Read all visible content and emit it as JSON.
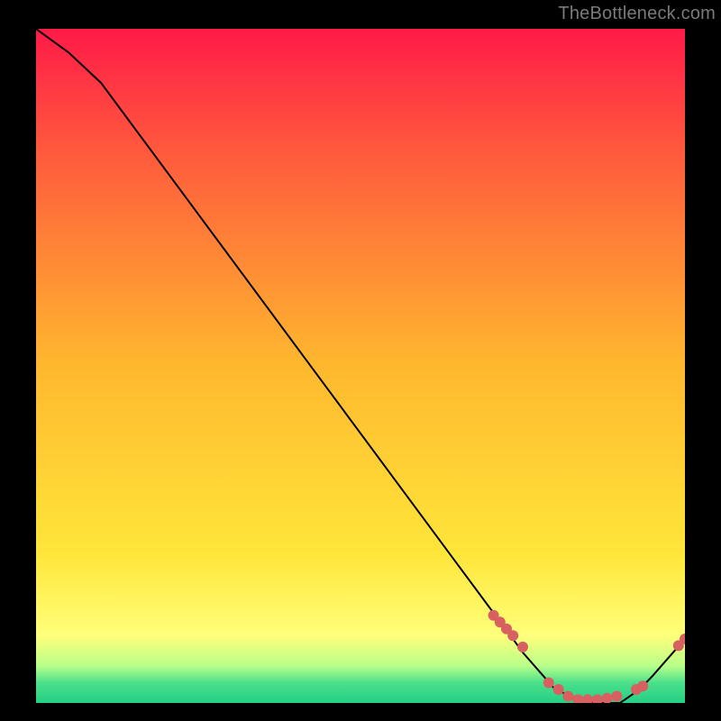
{
  "watermark": "TheBottleneck.com",
  "colors": {
    "bg": "#000000",
    "line": "#000000",
    "dot": "#d96060",
    "watermark": "#7a7a7a",
    "grad_top": "#ff1a48",
    "grad_upper": "#ff593d",
    "grad_mid": "#ffb82e",
    "grad_lower": "#ffe63a",
    "grad_pale": "#ffff7a",
    "grad_green1": "#b8ff8a",
    "grad_green2": "#4be08a",
    "grad_green3": "#24cf85"
  },
  "chart_data": {
    "type": "line",
    "title": "",
    "xlabel": "",
    "ylabel": "",
    "xlim": [
      0,
      100
    ],
    "ylim": [
      0,
      100
    ],
    "x": [
      0,
      5,
      10,
      15,
      20,
      25,
      30,
      35,
      40,
      45,
      50,
      55,
      60,
      65,
      70,
      72,
      75,
      80,
      85,
      90,
      93,
      95,
      100
    ],
    "values": [
      100,
      96.5,
      92,
      85.5,
      79,
      72.5,
      66,
      59.5,
      53,
      46.5,
      40,
      33.5,
      27,
      20.5,
      14,
      11.5,
      7.5,
      2,
      0,
      0,
      2,
      4,
      9.5
    ],
    "dots_x": [
      70.5,
      71.5,
      72.5,
      73.5,
      75,
      79,
      80.5,
      82,
      83.5,
      85,
      86.5,
      88,
      89.5,
      92.5,
      93.5,
      99,
      100
    ],
    "dots_y": [
      13,
      12,
      11,
      10,
      8.3,
      3,
      2,
      1,
      0.5,
      0.5,
      0.5,
      0.7,
      1,
      2,
      2.5,
      8.5,
      9.5
    ]
  }
}
